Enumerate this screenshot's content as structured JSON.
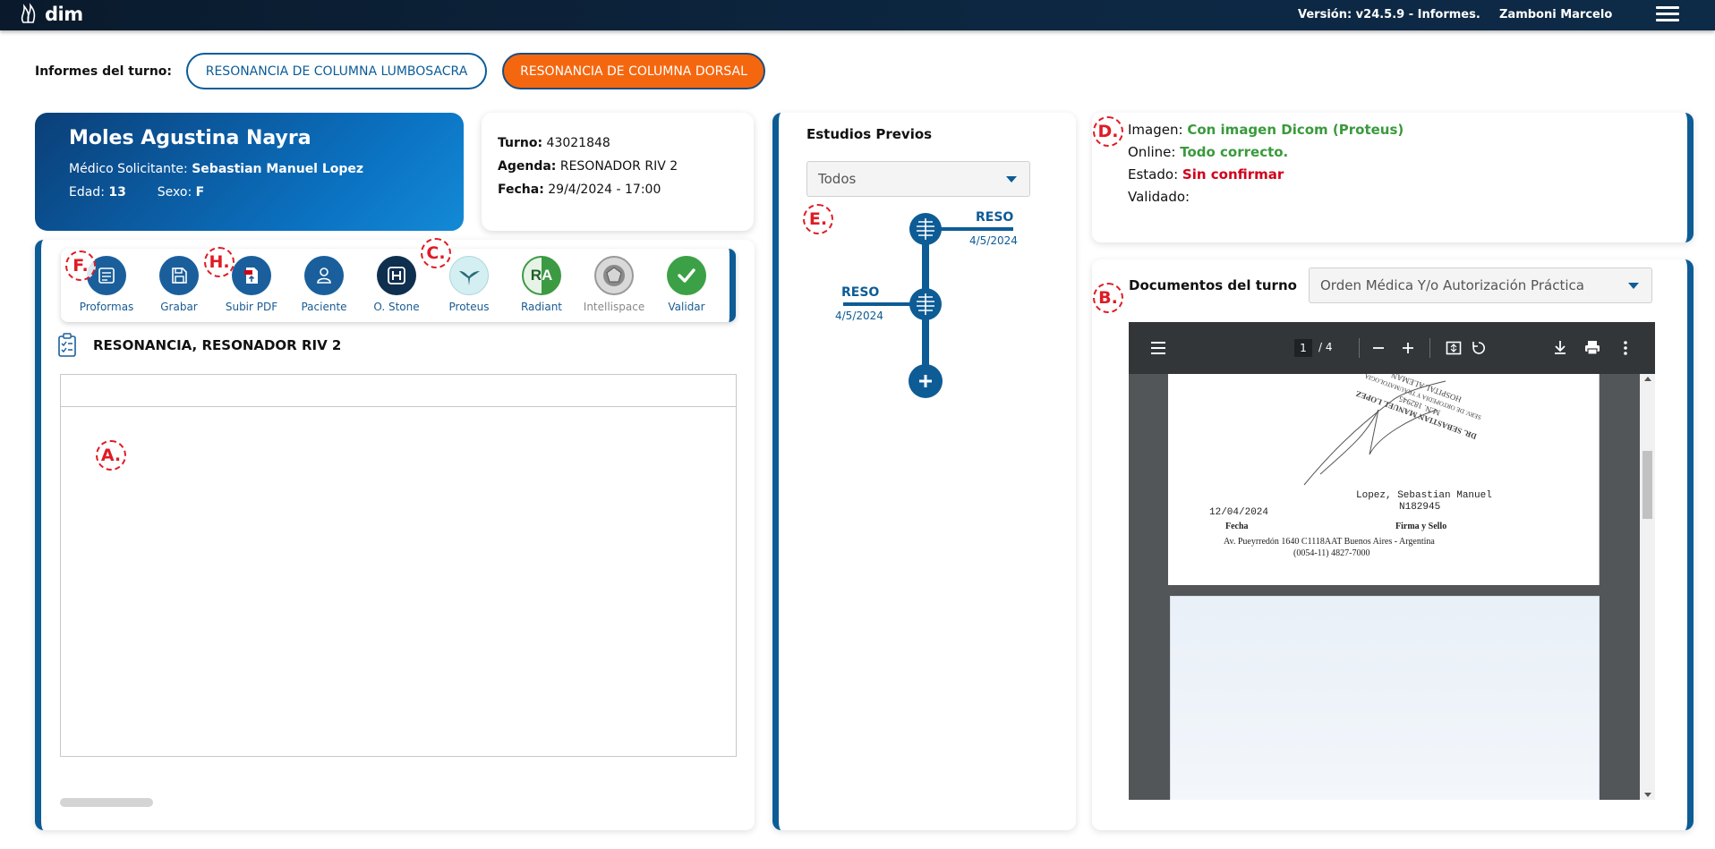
{
  "header": {
    "logo_text": "dim",
    "version": "Versión: v24.5.9 - Informes.",
    "user": "Zamboni Marcelo"
  },
  "turno_bar": {
    "label": "Informes del turno:",
    "reports": [
      {
        "label": "RESONANCIA DE COLUMNA LUMBOSACRA",
        "active": false
      },
      {
        "label": "RESONANCIA DE COLUMNA DORSAL",
        "active": true
      }
    ]
  },
  "patient": {
    "name": "Moles Agustina Nayra",
    "medico_label": "Médico Solicitante:",
    "medico": "Sebastian Manuel Lopez",
    "edad_label": "Edad:",
    "edad": "13",
    "sexo_label": "Sexo:",
    "sexo": "F"
  },
  "turno": {
    "turno_label": "Turno:",
    "turno": "43021848",
    "agenda_label": "Agenda:",
    "agenda": "RESONADOR RIV 2",
    "fecha_label": "Fecha:",
    "fecha": "29/4/2024 - 17:00"
  },
  "toolbar": {
    "items": [
      {
        "label": "Proformas",
        "icon": "proformas-icon"
      },
      {
        "label": "Grabar",
        "icon": "save-icon"
      },
      {
        "label": "Subir PDF",
        "icon": "pdf-upload-icon"
      },
      {
        "label": "Paciente",
        "icon": "patient-icon"
      },
      {
        "label": "O. Stone",
        "icon": "ostone-icon"
      },
      {
        "label": "Proteus",
        "icon": "proteus-icon"
      },
      {
        "label": "Radiant",
        "icon": "radiant-icon"
      },
      {
        "label": "Intellispace",
        "icon": "intellispace-icon"
      },
      {
        "label": "Validar",
        "icon": "check-icon"
      }
    ]
  },
  "report": {
    "title": "RESONANCIA, RESONADOR RIV 2"
  },
  "previous_studies": {
    "title": "Estudios Previos",
    "filter": "Todos",
    "items": [
      {
        "code": "RESO",
        "date": "4/5/2024"
      },
      {
        "code": "RESO",
        "date": "4/5/2024"
      }
    ]
  },
  "status": {
    "imagen_label": "Imagen:",
    "imagen": "Con imagen Dicom (Proteus)",
    "online_label": "Online:",
    "online": "Todo correcto.",
    "estado_label": "Estado:",
    "estado": "Sin confirmar",
    "validado_label": "Validado:",
    "validado": ""
  },
  "documents": {
    "title": "Documentos del turno",
    "selected": "Orden Médica Y/o Autorización Práctica",
    "viewer": {
      "page": "1",
      "total": "/ 4",
      "doc_name": "Lopez, Sebastian Manuel",
      "doc_number": "N182945",
      "date": "12/04/2024",
      "fecha_label": "Fecha",
      "firma_label": "Firma y Sello",
      "address": "Av. Pueyrredón 1640 C1118AAT Buenos Aires - Argentina",
      "phone": "(0054-11) 4827-7000",
      "stamp_line1": "DR. SEBASTIAN MANUEL LOPEZ",
      "stamp_line2": "M.N. 182945",
      "stamp_line3": "SERV. DE ORTOPEDIA Y TRAUMATOLOGIA",
      "stamp_line4": "HOSPITAL ALEMAN"
    }
  },
  "markers": [
    "A.",
    "B.",
    "C.",
    "D.",
    "E.",
    "F.",
    "H."
  ],
  "colors": {
    "brand_blue": "#0d5c96",
    "accent_orange": "#f5670f",
    "ok_green": "#3a9a3c",
    "alert_red": "#d0021b"
  }
}
